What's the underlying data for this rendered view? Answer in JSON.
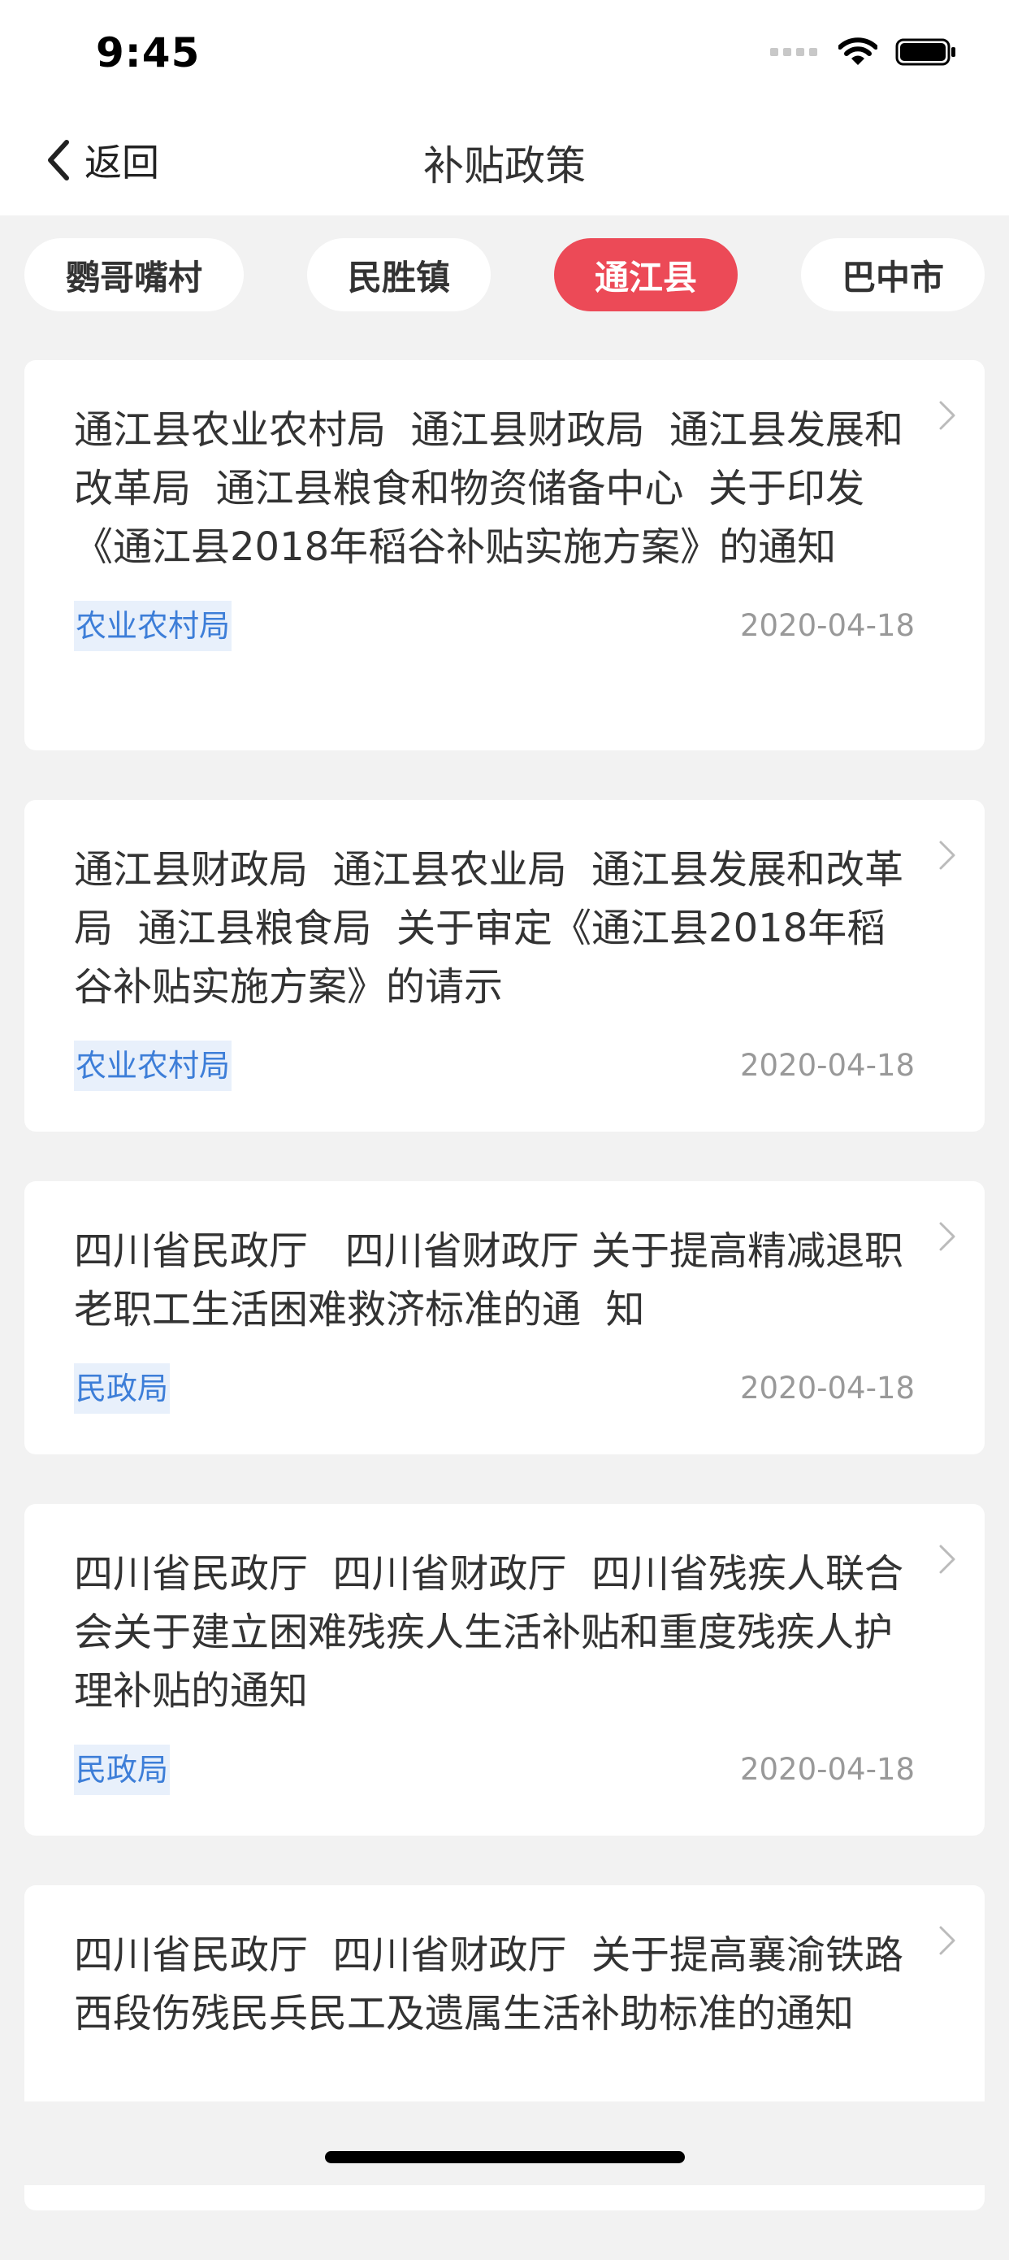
{
  "status": {
    "time": "9:45"
  },
  "nav": {
    "back_label": "返回",
    "title": "补贴政策"
  },
  "tabs": [
    {
      "label": "鹦哥嘴村",
      "active": false
    },
    {
      "label": "民胜镇",
      "active": false
    },
    {
      "label": "通江县",
      "active": true
    },
    {
      "label": "巴中市",
      "active": false
    }
  ],
  "colors": {
    "accent": "#ec4a57",
    "tag_text": "#3d7ed8",
    "tag_bg": "#e8f0fb"
  },
  "items": [
    {
      "title": "通江县农业农村局  通江县财政局  通江县发展和改革局  通江县粮食和物资储备中心  关于印发《通江县2018年稻谷补贴实施方案》的通知",
      "tag": "农业农村局",
      "date": "2020-04-18"
    },
    {
      "title": "通江县财政局  通江县农业局  通江县发展和改革局  通江县粮食局  关于审定《通江县2018年稻谷补贴实施方案》的请示",
      "tag": "农业农村局",
      "date": "2020-04-18"
    },
    {
      "title": "四川省民政厅   四川省财政厅 关于提高精减退职老职工生活困难救济标准的通  知",
      "tag": "民政局",
      "date": "2020-04-18"
    },
    {
      "title": "四川省民政厅  四川省财政厅  四川省残疾人联合会关于建立困难残疾人生活补贴和重度残疾人护理补贴的通知",
      "tag": "民政局",
      "date": "2020-04-18"
    },
    {
      "title": "四川省民政厅  四川省财政厅  关于提高襄渝铁路西段伤残民兵民工及遗属生活补助标准的通知",
      "tag": "",
      "date": ""
    }
  ]
}
